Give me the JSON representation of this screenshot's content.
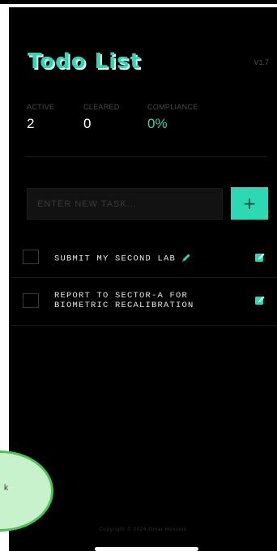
{
  "app": {
    "title": "Todo List",
    "version": "V1.7"
  },
  "stats": {
    "active": {
      "label": "ACTIVE",
      "value": "2"
    },
    "cleared": {
      "label": "CLEARED",
      "value": "0"
    },
    "compliance": {
      "label": "COMPLIANCE",
      "value": "0%"
    }
  },
  "new_task": {
    "placeholder": "ENTER NEW TASK...",
    "value": "",
    "add_label": "+"
  },
  "tasks": [
    {
      "text": "SUBMIT MY SECOND LAB",
      "completed": false,
      "has_pencil": true
    },
    {
      "text": "REPORT TO SECTOR-A FOR BIOMETRIC RECALIBRATION",
      "completed": false,
      "has_pencil": false
    }
  ],
  "footer": {
    "copyright": "Copyright © 2024 Omar Hussein"
  },
  "overlay_bubble": {
    "text": "k"
  },
  "colors": {
    "accent": "#2bd9b5",
    "background": "#000000",
    "bubble_fill": "#c7f2cb",
    "bubble_border": "#49c556"
  },
  "icons": {
    "add": "plus-icon",
    "edit": "edit-icon",
    "pencil": "pencil-icon",
    "checkbox": "checkbox-icon"
  }
}
